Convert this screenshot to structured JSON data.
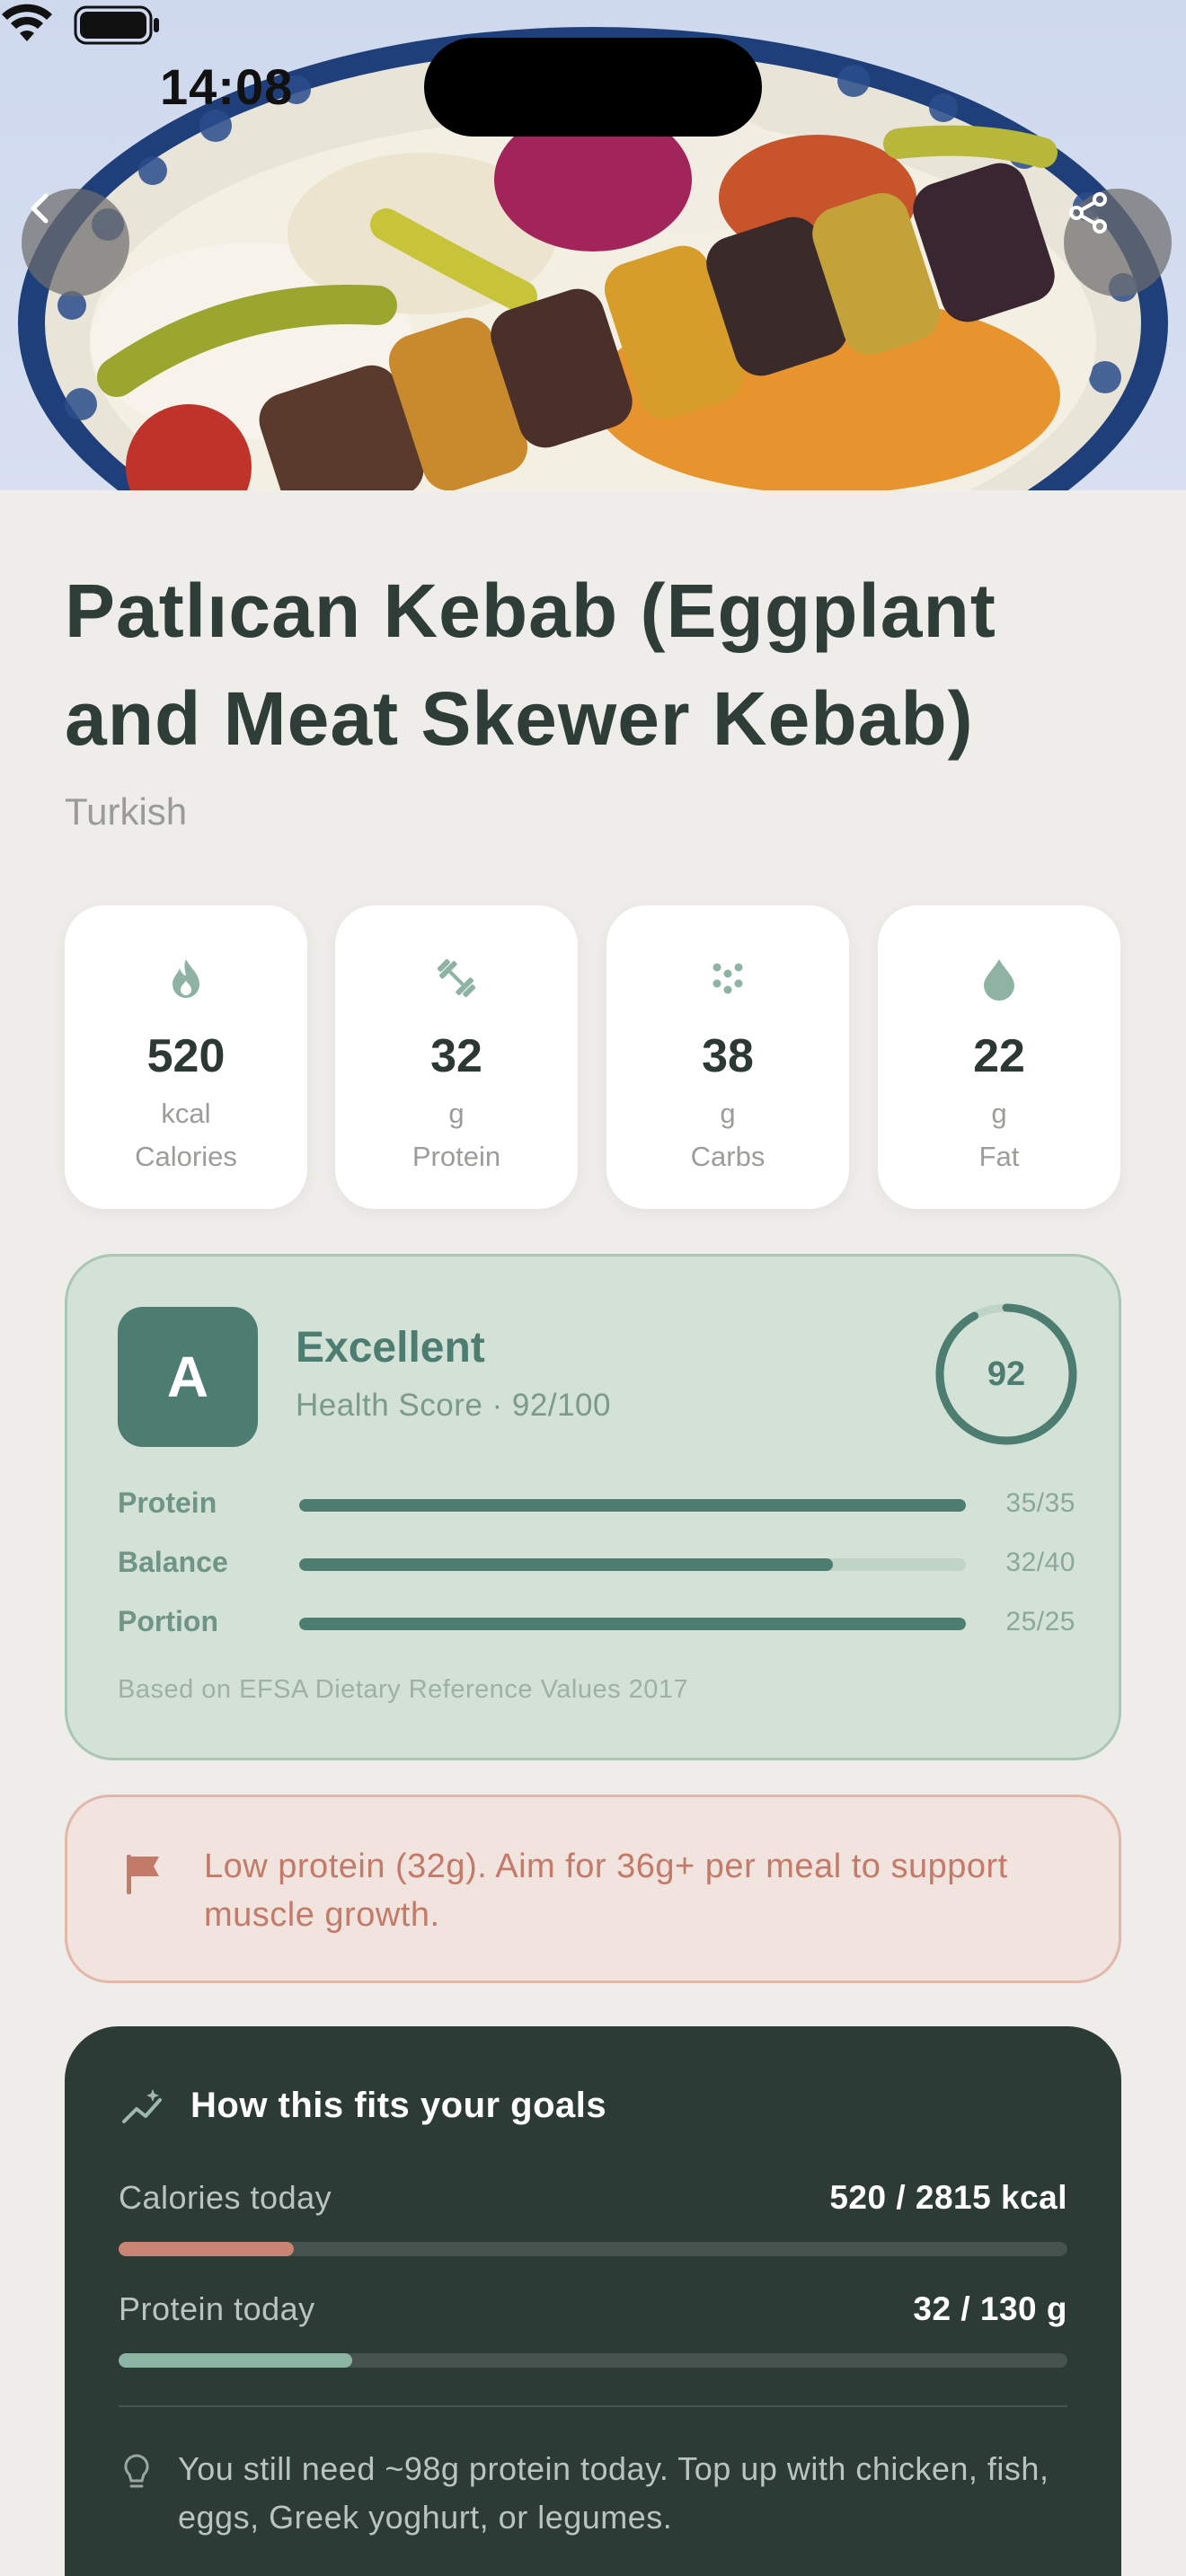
{
  "status_bar": {
    "time": "14:08"
  },
  "dish": {
    "title": "Patlıcan Kebab (Eggplant and Meat Skewer Kebab)",
    "cuisine": "Turkish"
  },
  "nav": {
    "back_icon": "chevron-left-icon",
    "share_icon": "share-icon"
  },
  "macros": [
    {
      "icon": "flame-icon",
      "value": "520",
      "unit": "kcal",
      "label": "Calories"
    },
    {
      "icon": "dumbbell-icon",
      "value": "32",
      "unit": "g",
      "label": "Protein"
    },
    {
      "icon": "grain-icon",
      "value": "38",
      "unit": "g",
      "label": "Carbs"
    },
    {
      "icon": "drop-icon",
      "value": "22",
      "unit": "g",
      "label": "Fat"
    }
  ],
  "health": {
    "grade": "A",
    "title": "Excellent",
    "subtitle": "Health Score · 92/100",
    "score": "92",
    "score_fraction": 0.92,
    "rows": [
      {
        "label": "Protein",
        "value": "35/35",
        "fraction": 1.0
      },
      {
        "label": "Balance",
        "value": "32/40",
        "fraction": 0.8
      },
      {
        "label": "Portion",
        "value": "25/25",
        "fraction": 1.0
      }
    ],
    "note": "Based on EFSA Dietary Reference Values 2017"
  },
  "warning": {
    "icon": "flag-icon",
    "text": "Low protein (32g). Aim for 36g+ per meal to support muscle growth."
  },
  "goals": {
    "icon": "trend-icon",
    "title": "How this fits your goals",
    "rows": [
      {
        "label": "Calories today",
        "value": "520 / 2815 kcal",
        "fraction": 0.185,
        "color": "#c98473"
      },
      {
        "label": "Protein today",
        "value": "32 / 130 g",
        "fraction": 0.246,
        "color": "#8db5a3"
      }
    ],
    "tip_icon": "lightbulb-icon",
    "tip": "You still need ~98g protein today. Top up with chicken, fish, eggs, Greek yoghurt, or legumes."
  },
  "colors": {
    "accent": "#4d7c70",
    "warning": "#c47a68",
    "dark_card": "#2d3b37"
  }
}
